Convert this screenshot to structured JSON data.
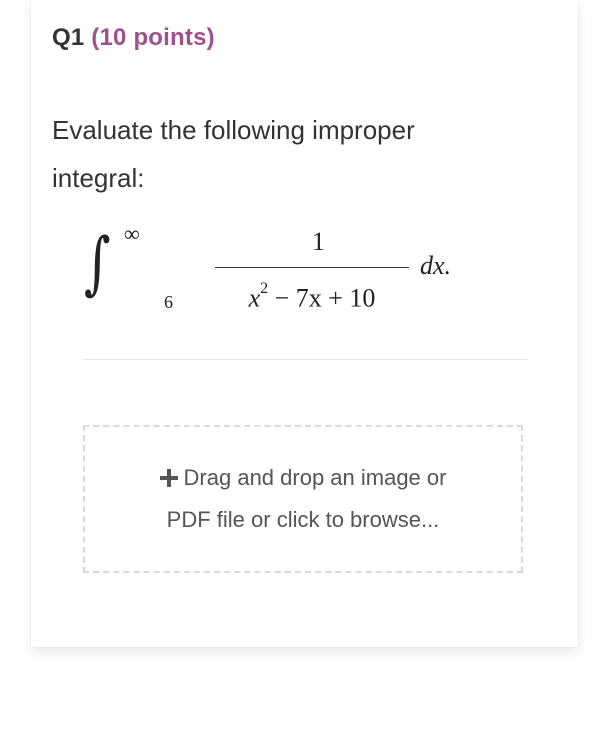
{
  "question": {
    "number": "Q1",
    "points": "(10 points)",
    "prompt": "Evaluate the following improper integral:"
  },
  "math": {
    "integral_sign": "∫",
    "upper_limit": "∞",
    "lower_limit": "6",
    "numerator": "1",
    "denominator_var": "x",
    "denominator_exp": "2",
    "denominator_rest": " − 7x + 10",
    "differential": "dx."
  },
  "upload": {
    "line1": "Drag and drop an image or",
    "line2": "PDF file or click to browse..."
  },
  "colors": {
    "points_accent": "#a0508f",
    "text": "#333333",
    "dropzone_border": "#d9d9d9"
  },
  "icons": {
    "upload": "plus-icon"
  }
}
